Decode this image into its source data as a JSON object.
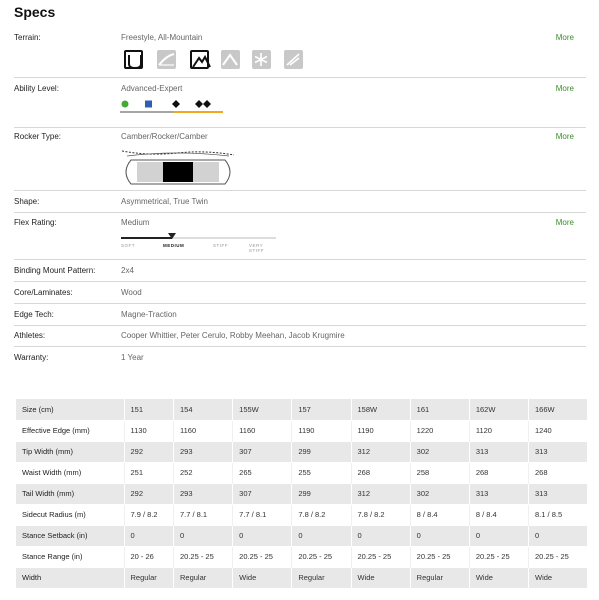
{
  "title": "Specs",
  "more_label": "More",
  "terrain": {
    "label": "Terrain:",
    "value": "Freestyle, All-Mountain",
    "icons": [
      {
        "name": "park-terrain-icon",
        "active": true
      },
      {
        "name": "halfpipe-terrain-icon",
        "active": false
      },
      {
        "name": "all-mountain-terrain-icon",
        "active": true
      },
      {
        "name": "freeride-terrain-icon",
        "active": false
      },
      {
        "name": "powder-terrain-icon",
        "active": false
      },
      {
        "name": "backcountry-terrain-icon",
        "active": false
      }
    ]
  },
  "ability": {
    "label": "Ability Level:",
    "value": "Advanced-Expert",
    "levels": [
      "beginner",
      "intermediate",
      "advanced",
      "expert"
    ],
    "colors": {
      "beginner": "#44aa33",
      "intermediate": "#2f5fb3",
      "advanced": "#111111",
      "expert": "#111111",
      "highlight": "#f2a81d"
    }
  },
  "rocker": {
    "label": "Rocker Type:",
    "value": "Camber/Rocker/Camber"
  },
  "shape": {
    "label": "Shape:",
    "value": "Asymmetrical, True Twin"
  },
  "flex": {
    "label": "Flex Rating:",
    "value": "Medium",
    "scale": [
      "SOFT",
      "MEDIUM",
      "STIFF",
      "VERY STIFF"
    ],
    "level": 0.33
  },
  "binding": {
    "label": "Binding Mount Pattern:",
    "value": "2x4"
  },
  "core": {
    "label": "Core/Laminates:",
    "value": "Wood"
  },
  "edge": {
    "label": "Edge Tech:",
    "value": "Magne-Traction"
  },
  "athletes": {
    "label": "Athletes:",
    "value": "Cooper Whittier, Peter Cerulo, Robby Meehan, Jacob Krugmire"
  },
  "warranty": {
    "label": "Warranty:",
    "value": "1 Year"
  },
  "table": {
    "rows": [
      {
        "label": "Size (cm)",
        "cells": [
          "151",
          "154",
          "155W",
          "157",
          "158W",
          "161",
          "162W",
          "166W"
        ]
      },
      {
        "label": "Effective Edge (mm)",
        "cells": [
          "1130",
          "1160",
          "1160",
          "1190",
          "1190",
          "1220",
          "1120",
          "1240"
        ]
      },
      {
        "label": "Tip Width (mm)",
        "cells": [
          "292",
          "293",
          "307",
          "299",
          "312",
          "302",
          "313",
          "313"
        ]
      },
      {
        "label": "Waist Width (mm)",
        "cells": [
          "251",
          "252",
          "265",
          "255",
          "268",
          "258",
          "268",
          "268"
        ]
      },
      {
        "label": "Tail Width (mm)",
        "cells": [
          "292",
          "293",
          "307",
          "299",
          "312",
          "302",
          "313",
          "313"
        ]
      },
      {
        "label": "Sidecut Radius (m)",
        "cells": [
          "7.9 / 8.2",
          "7.7 / 8.1",
          "7.7 / 8.1",
          "7.8 / 8.2",
          "7.8 / 8.2",
          "8 / 8.4",
          "8 / 8.4",
          "8.1 / 8.5"
        ]
      },
      {
        "label": "Stance Setback (in)",
        "cells": [
          "0",
          "0",
          "0",
          "0",
          "0",
          "0",
          "0",
          "0"
        ]
      },
      {
        "label": "Stance Range (in)",
        "cells": [
          "20 - 26",
          "20.25 - 25",
          "20.25 - 25",
          "20.25 - 25",
          "20.25 - 25",
          "20.25 - 25",
          "20.25 - 25",
          "20.25 - 25"
        ]
      },
      {
        "label": "Width",
        "cells": [
          "Regular",
          "Regular",
          "Wide",
          "Regular",
          "Wide",
          "Regular",
          "Wide",
          "Wide"
        ]
      }
    ]
  }
}
